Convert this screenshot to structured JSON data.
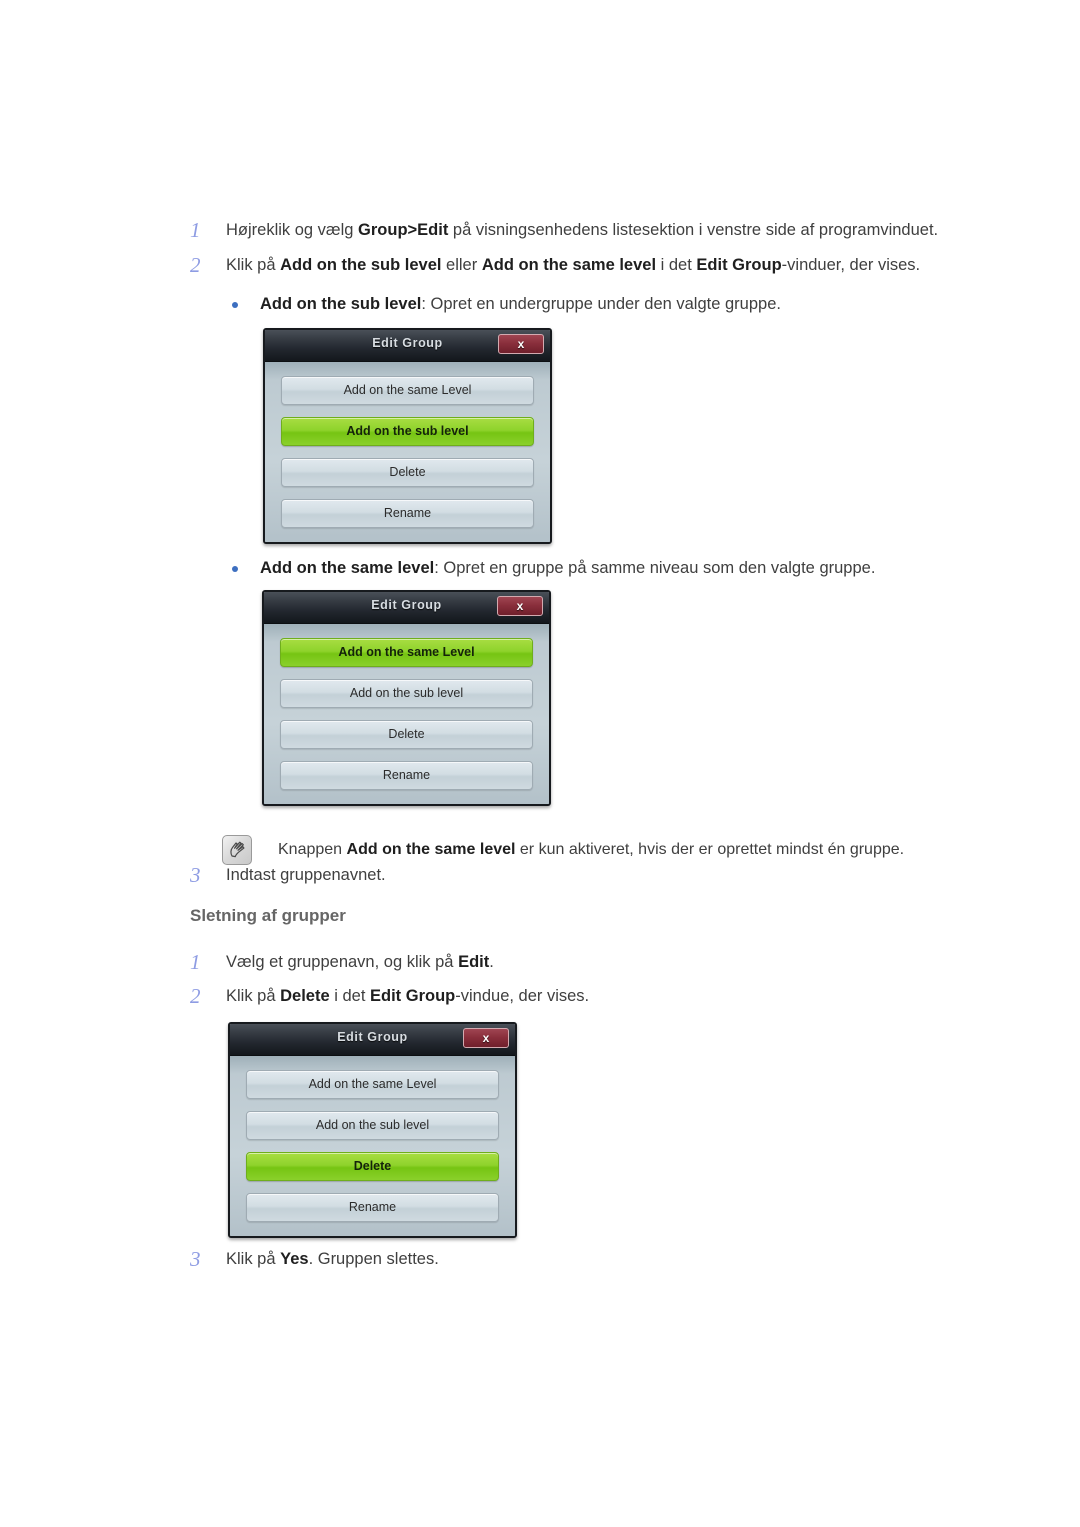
{
  "document": {
    "language": "da",
    "steps_top": [
      {
        "num": "1",
        "html": "Højreklik og vælg <b>Group&gt;Edit</b> på visningsenhedens listesektion i venstre side af programvinduet."
      },
      {
        "num": "2",
        "html": "Klik på <b>Add on the sub level</b> eller <b>Add on the same level</b> i det <b>Edit Group</b>-vinduer, der vises."
      }
    ],
    "bullets": [
      {
        "html": "<b>Add on the sub level</b>: Opret en undergruppe under den valgte gruppe."
      },
      {
        "html": "<b>Add on the same level</b>: Opret en gruppe på samme niveau som den valgte gruppe."
      }
    ],
    "note": {
      "icon": "note-hand-icon",
      "html": "Knappen <b>Add on the same level</b> er kun aktiveret, hvis der er oprettet mindst én gruppe."
    },
    "step3_top": {
      "num": "3",
      "html": "Indtast gruppenavnet."
    },
    "section_heading": "Sletning af grupper",
    "steps_bottom": [
      {
        "num": "1",
        "html": "Vælg et gruppenavn, og klik på <b>Edit</b>."
      },
      {
        "num": "2",
        "html": "Klik på <b>Delete</b> i det <b>Edit Group</b>-vindue, der vises."
      }
    ],
    "step3_bottom": {
      "num": "3",
      "html": "Klik på <b>Yes</b>. Gruppen slettes."
    }
  },
  "dialogs": [
    {
      "id": "dialog-sub-level",
      "title": "Edit Group",
      "close_label": "x",
      "buttons": [
        {
          "label": "Add on the same Level",
          "selected": false
        },
        {
          "label": "Add on the sub level",
          "selected": true
        },
        {
          "label": "Delete",
          "selected": false
        },
        {
          "label": "Rename",
          "selected": false
        }
      ]
    },
    {
      "id": "dialog-same-level",
      "title": "Edit Group",
      "close_label": "x",
      "buttons": [
        {
          "label": "Add on the same Level",
          "selected": true
        },
        {
          "label": "Add on the sub level",
          "selected": false
        },
        {
          "label": "Delete",
          "selected": false
        },
        {
          "label": "Rename",
          "selected": false
        }
      ]
    },
    {
      "id": "dialog-delete",
      "title": "Edit Group",
      "close_label": "x",
      "buttons": [
        {
          "label": "Add on the same Level",
          "selected": false
        },
        {
          "label": "Add on the sub level",
          "selected": false
        },
        {
          "label": "Delete",
          "selected": true
        },
        {
          "label": "Rename",
          "selected": false
        }
      ]
    }
  ],
  "colors": {
    "step_number": "#8e9ce3",
    "bullet_dot": "#3d6fc0",
    "heading": "#666666",
    "body_text": "#3f3f3f",
    "selected_button_green": "#8fd32c",
    "close_button_red": "#8a2f3c",
    "dialog_titlebar_dark": "#22272e"
  }
}
